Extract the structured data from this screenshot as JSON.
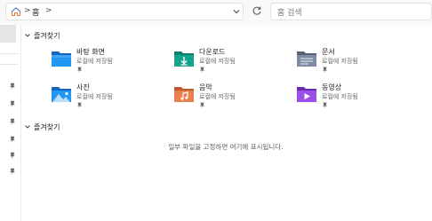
{
  "address": {
    "crumb": "홈",
    "separator": ">",
    "search_placeholder": "홈 검색"
  },
  "quick_access": {
    "header": "즐겨찾기",
    "items": [
      {
        "name": "바탕 화면",
        "subtitle": "로컬에 저장됨",
        "icon": "desktop-folder-icon",
        "color": "#1e88d8"
      },
      {
        "name": "다운로드",
        "subtitle": "로컬에 저장됨",
        "icon": "downloads-folder-icon",
        "color": "#15a38a"
      },
      {
        "name": "문서",
        "subtitle": "로컬에 저장됨",
        "icon": "documents-folder-icon",
        "color": "#6b7d94"
      },
      {
        "name": "사진",
        "subtitle": "로컬에 저장됨",
        "icon": "pictures-folder-icon",
        "color": "#1e88d8"
      },
      {
        "name": "음악",
        "subtitle": "로컬에 저장됨",
        "icon": "music-folder-icon",
        "color": "#e0764a"
      },
      {
        "name": "동영상",
        "subtitle": "로컬에 저장됨",
        "icon": "videos-folder-icon",
        "color": "#8b3fd6"
      }
    ]
  },
  "favorites": {
    "header": "즐겨찾기",
    "empty_message": "일부 파일을 고정하면 여기에 표시됩니다."
  }
}
